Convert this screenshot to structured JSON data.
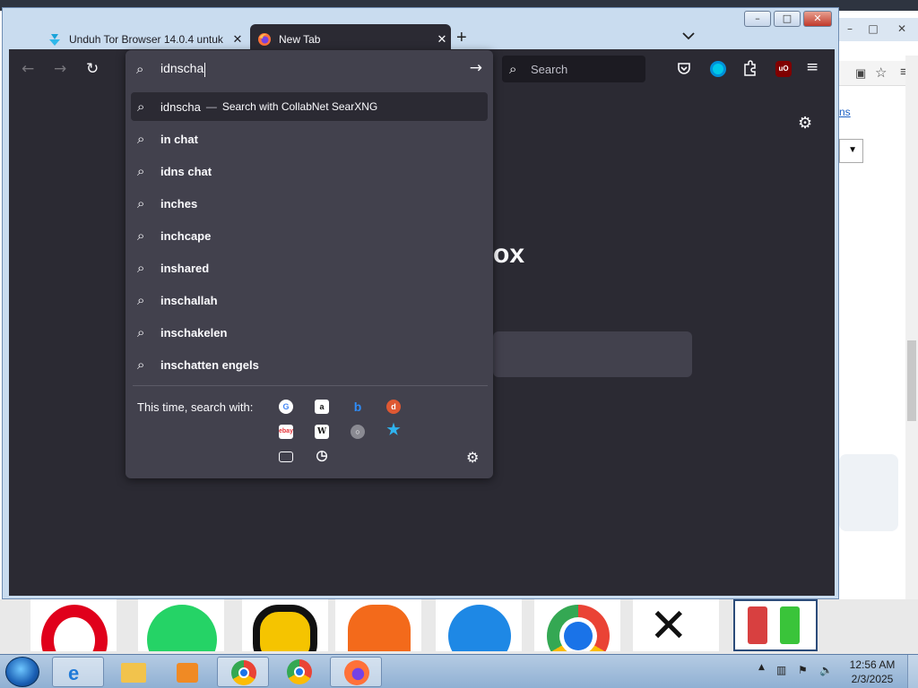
{
  "background_window": {
    "link_fragment": "ns"
  },
  "tabs": [
    {
      "title": "Unduh Tor Browser 14.0.4 untuk",
      "close": "✕",
      "active": false
    },
    {
      "title": "New Tab",
      "close": "✕",
      "active": true
    }
  ],
  "tabstrip": {
    "new_tab": "+",
    "list_all_tabs": "⌄"
  },
  "window_controls": {
    "minimize": "–",
    "maximize": "□",
    "close": "✕"
  },
  "toolbar": {
    "back": "←",
    "forward": "→",
    "reload": "↻",
    "search_placeholder": "Search"
  },
  "urlbar": {
    "value": "idnscha",
    "go": "→"
  },
  "suggestions": {
    "first": {
      "term": "idnscha",
      "separator": "—",
      "action": "Search with CollabNet SearXNG"
    },
    "items": [
      "in chat",
      "idns chat",
      "inches",
      "inchcape",
      "inshared",
      "inschallah",
      "inschakelen",
      "inschatten engels"
    ]
  },
  "one_offs": {
    "label": "This time, search with:",
    "engines": [
      "google-icon",
      "amazon-icon",
      "bing-icon",
      "duckduckgo-icon",
      "ebay-icon",
      "wikipedia-icon",
      "searxng-icon",
      "bookmark-star-icon",
      "tabs-icon",
      "history-icon"
    ]
  },
  "newtab": {
    "logo_fragment": "ox"
  },
  "taskbar": {
    "time": "12:56 AM",
    "date": "2/3/2025"
  },
  "colors": {
    "firefox_dark": "#2b2a33",
    "popup_bg": "#42414d",
    "text": "#fbfbfe"
  }
}
